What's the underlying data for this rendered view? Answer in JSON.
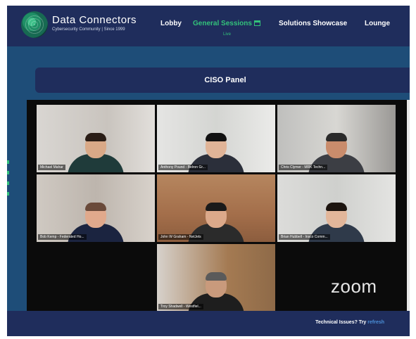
{
  "header": {
    "brand_title": "Data Connectors",
    "brand_subtitle": "Cybersecurity Community | Since 1999",
    "nav": [
      {
        "label": "Lobby"
      },
      {
        "label": "General Sessions"
      },
      {
        "label": "Solutions Showcase"
      },
      {
        "label": "Lounge"
      }
    ],
    "live_label": "Live"
  },
  "panel": {
    "title": "CISO Panel"
  },
  "participants": [
    {
      "name": "Michael Mahar"
    },
    {
      "name": "Anthony Pound - Belron Gr..."
    },
    {
      "name": "Chris Clymer - MRK Techn..."
    },
    {
      "name": "Bob Kemp - Federated Ho..."
    },
    {
      "name": "John W Graham - NetJets"
    },
    {
      "name": "Brian Hubbell - Insco Comm..."
    },
    {
      "name": "Troy Shadwell - Westfiel..."
    }
  ],
  "video": {
    "watermark": "zoom"
  },
  "footer": {
    "text": "Technical Issues? Try ",
    "link": "refresh"
  },
  "colors": {
    "header_bg": "#1f2d5c",
    "page_bg": "#1e4d78",
    "accent": "#33c27a",
    "speaker_outline": "#4cc93c"
  }
}
